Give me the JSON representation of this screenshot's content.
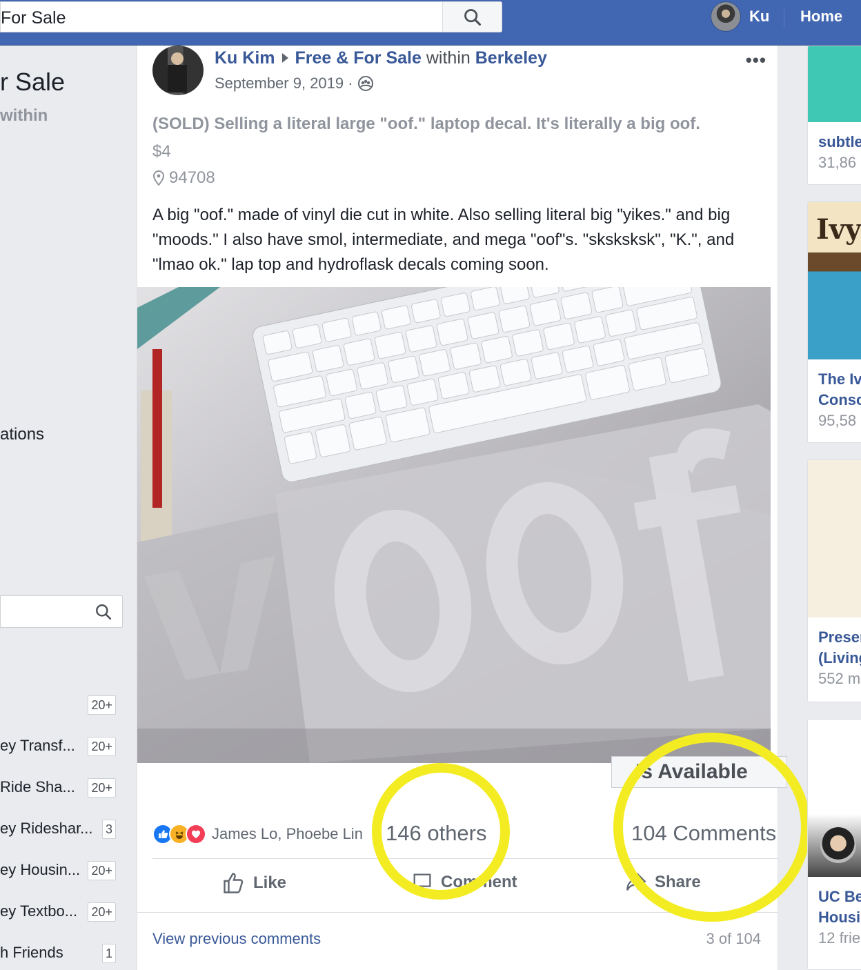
{
  "topbar": {
    "search_value": "For Sale",
    "user_name": "Ku",
    "home_label": "Home"
  },
  "left": {
    "title_fragment": "r Sale",
    "subtitle_fragment": "within",
    "section_fragment": "ations",
    "groups": [
      {
        "label": "",
        "badge": "20+"
      },
      {
        "label": "ey Transf...",
        "badge": "20+"
      },
      {
        "label": "Ride Sha...",
        "badge": "20+"
      },
      {
        "label": "ey Rideshаr...",
        "badge": "3"
      },
      {
        "label": "ey Housin...",
        "badge": "20+"
      },
      {
        "label": "ey Textbo...",
        "badge": "20+"
      },
      {
        "label": "h Friends",
        "badge": "1"
      }
    ]
  },
  "post": {
    "author": "Ku Kim",
    "group": "Free & For Sale",
    "within_label": "within",
    "location_group": "Berkeley",
    "date": "September 9, 2019 ·",
    "more_label": "•••",
    "title": "(SOLD) Selling a literal large \"oof.\" laptop decal. It's literally a big oof.",
    "price": "$4",
    "zip": "94708",
    "description": "A big \"oof.\" made of vinyl die cut in white. Also selling literal big \"yikes.\" and big \"moods.\" I also have smol, intermediate, and mega \"oof\"s. \"sksksksk\", \"K.\", and \"lmao ok.\" lap top and hydroflask decals coming soon.",
    "photo_text": "oof",
    "photo_text_faint": "Y",
    "availability": "Is Available",
    "reaction_names": "James Lo, Phoebe Lin",
    "others": "146 others",
    "comments": "104 Comments",
    "like_label": "Like",
    "comment_label": "Comment",
    "share_label": "Share",
    "view_previous": "View previous comments",
    "comment_page": "3 of 104"
  },
  "right": {
    "cards": [
      {
        "title": "subtle",
        "sub": "31,86"
      },
      {
        "title": "The Iv",
        "title2": "Consc",
        "sub": "95,58",
        "image_word": "Ivy"
      },
      {
        "title": "Preser",
        "title2": "(Living",
        "sub": "552 m"
      },
      {
        "title": "UC Be",
        "title2": "Housir",
        "sub": "12 frie"
      }
    ]
  },
  "colors": {
    "brand": "#4267b2",
    "link": "#385898",
    "highlight": "#f4ec23"
  }
}
